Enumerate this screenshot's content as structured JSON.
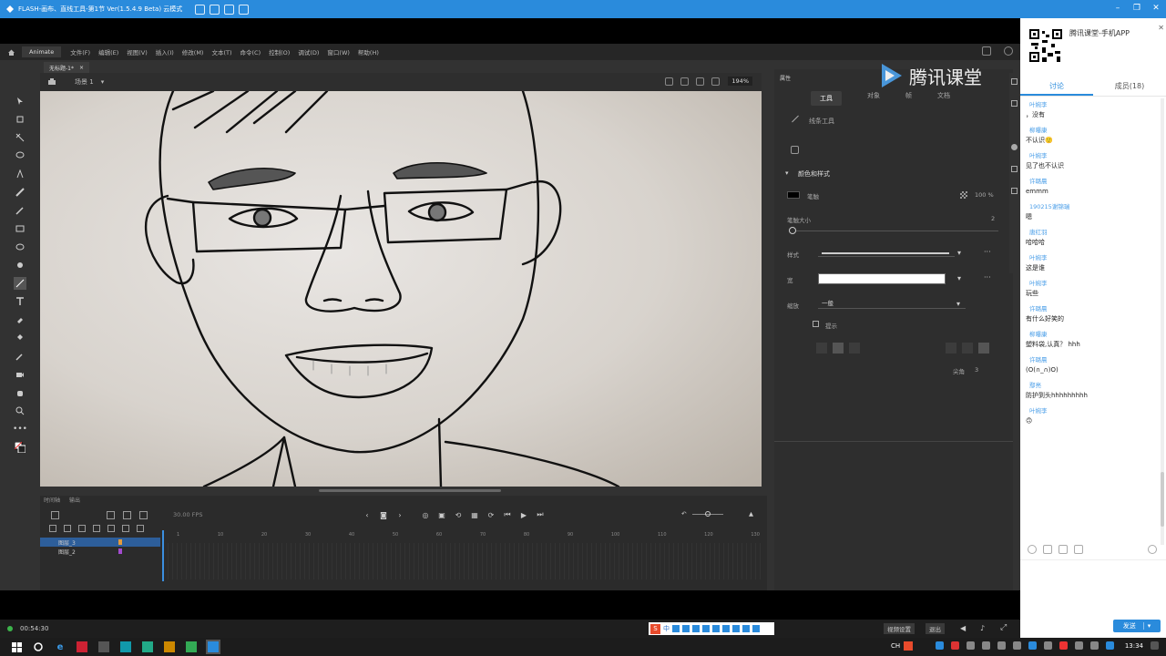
{
  "title_bar": {
    "title": "FLASH-画布、直线工具-第1节 Ver(1.5.4.9 Beta) 云模式"
  },
  "menubar": {
    "brand": "Animate",
    "items": [
      "文件(F)",
      "编辑(E)",
      "视图(V)",
      "插入(I)",
      "修改(M)",
      "文本(T)",
      "命令(C)",
      "控制(O)",
      "调试(D)",
      "窗口(W)",
      "帮助(H)"
    ]
  },
  "document": {
    "tab": "无标题-1*",
    "scene": "场景 1",
    "zoom": "194%"
  },
  "watermark": {
    "brand": "腾讯课堂"
  },
  "properties": {
    "panel_title": "属性",
    "tabs": [
      "工具",
      "对象",
      "帧",
      "文档"
    ],
    "tool_name": "线条工具",
    "section": "颜色和样式",
    "stroke_label": "笔触",
    "stroke_opacity": "100 %",
    "stroke_size_label": "笔触大小",
    "stroke_size": "2",
    "style_label": "样式",
    "width_label": "宽",
    "scale_label": "缩放",
    "scale_value": "一般",
    "hint_label": "提示",
    "join_label": "尖角",
    "join_value": "3"
  },
  "timeline": {
    "tabs": [
      "时间轴",
      "输出"
    ],
    "fps": "30.00 FPS",
    "layers": [
      "图层_3",
      "图层_2"
    ],
    "frame_marks": [
      "1",
      "5",
      "10",
      "15",
      "20",
      "25",
      "30",
      "35",
      "40",
      "45",
      "50",
      "55",
      "60",
      "65",
      "70",
      "75",
      "80",
      "85",
      "90",
      "95",
      "100",
      "105",
      "110",
      "115",
      "120",
      "125",
      "130",
      "135"
    ]
  },
  "video_bar": {
    "time": "00:54:30",
    "btn_video": "视频设置",
    "btn_quit": "退出"
  },
  "ime": {
    "zh": "中"
  },
  "tencent": {
    "app_label": "腾讯课堂-手机APP",
    "tab_discuss": "讨论",
    "tab_members": "成员(18)",
    "send": "发送",
    "messages": [
      {
        "name": "叶婉李",
        "text": "，没有"
      },
      {
        "name": "柳曝康",
        "text": "不认识🙂"
      },
      {
        "name": "叶婉李",
        "text": "见了也不认识"
      },
      {
        "name": "许璐晨",
        "text": "emmm"
      },
      {
        "name": "190215谢锦瑞",
        "text": "嗯"
      },
      {
        "name": "唐红羽",
        "text": "哈哈哈"
      },
      {
        "name": "叶婉李",
        "text": "这是谁"
      },
      {
        "name": "叶婉李",
        "text": "玩些"
      },
      {
        "name": "许璐晨",
        "text": "有什么好笑的"
      },
      {
        "name": "柳曝康",
        "text": "塑料袋,认真？ hhh"
      },
      {
        "name": "许璐晨",
        "text": "(O(∩_∩)O)"
      },
      {
        "name": "鄢亮",
        "text": "防护到头hhhhhhhhh"
      },
      {
        "name": "叶婉李",
        "text": "🙃"
      }
    ]
  },
  "taskbar": {
    "lang": "CH",
    "clock": "13:34"
  }
}
